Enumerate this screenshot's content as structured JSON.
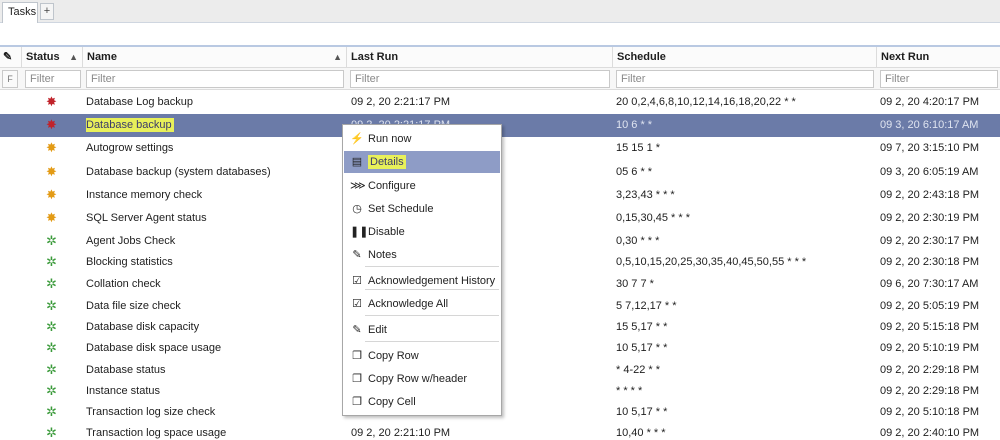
{
  "tabs": [
    {
      "label": "Tasks"
    }
  ],
  "add_tab_label": "+",
  "columns": {
    "status": "Status",
    "name": "Name",
    "last_run": "Last Run",
    "schedule": "Schedule",
    "next_run": "Next Run"
  },
  "filter": {
    "button": "F",
    "placeholder": "Filter"
  },
  "rows": [
    {
      "status": "error",
      "name": "Database Log backup",
      "last_run": "09 2, 20 2:21:17 PM",
      "schedule": "20 0,2,4,6,8,10,12,14,16,18,20,22 * *",
      "next_run": "09 2, 20 4:20:17 PM"
    },
    {
      "status": "error",
      "name": "Database backup",
      "last_run": "09 2, 20 2:21:17 PM",
      "schedule": "10 6 * *",
      "next_run": "09 3, 20 6:10:17 AM"
    },
    {
      "status": "warning",
      "name": "Autogrow settings",
      "last_run": "",
      "schedule": "15 15 1 *",
      "next_run": "09 7, 20 3:15:10 PM"
    },
    {
      "status": "warning",
      "name": "Database backup (system databases)",
      "last_run": "",
      "schedule": "05 6 * *",
      "next_run": "09 3, 20 6:05:19 AM"
    },
    {
      "status": "warning",
      "name": "Instance memory check",
      "last_run": "",
      "schedule": "3,23,43 * * *",
      "next_run": "09 2, 20 2:43:18 PM"
    },
    {
      "status": "warning",
      "name": "SQL Server Agent status",
      "last_run": "",
      "schedule": "0,15,30,45 * * *",
      "next_run": "09 2, 20 2:30:19 PM"
    },
    {
      "status": "ok",
      "name": "Agent Jobs Check",
      "last_run": "",
      "schedule": "0,30 * * *",
      "next_run": "09 2, 20 2:30:17 PM"
    },
    {
      "status": "ok",
      "name": "Blocking statistics",
      "last_run": "",
      "schedule": "0,5,10,15,20,25,30,35,40,45,50,55 * * *",
      "next_run": "09 2, 20 2:30:18 PM"
    },
    {
      "status": "ok",
      "name": "Collation check",
      "last_run": "",
      "schedule": "30 7 7 *",
      "next_run": "09 6, 20 7:30:17 AM"
    },
    {
      "status": "ok",
      "name": "Data file size check",
      "last_run": "",
      "schedule": "5 7,12,17 * *",
      "next_run": "09 2, 20 5:05:19 PM"
    },
    {
      "status": "ok",
      "name": "Database disk capacity",
      "last_run": "",
      "schedule": "15 5,17 * *",
      "next_run": "09 2, 20 5:15:18 PM"
    },
    {
      "status": "ok",
      "name": "Database disk space usage",
      "last_run": "",
      "schedule": "10 5,17 * *",
      "next_run": "09 2, 20 5:10:19 PM"
    },
    {
      "status": "ok",
      "name": "Database status",
      "last_run": "",
      "schedule": "* 4-22 * *",
      "next_run": "09 2, 20 2:29:18 PM"
    },
    {
      "status": "ok",
      "name": "Instance status",
      "last_run": "",
      "schedule": "* * * *",
      "next_run": "09 2, 20 2:29:18 PM"
    },
    {
      "status": "ok",
      "name": "Transaction log size check",
      "last_run": "",
      "schedule": "10 5,17 * *",
      "next_run": "09 2, 20 5:10:18 PM"
    },
    {
      "status": "ok",
      "name": "Transaction log space usage",
      "last_run": "09 2, 20 2:21:10 PM",
      "schedule": "10,40 * * *",
      "next_run": "09 2, 20 2:40:10 PM"
    }
  ],
  "context_menu": {
    "items": [
      {
        "label": "Run now",
        "icon": "lightning-icon",
        "glyph": "⚡"
      },
      {
        "label": "Details",
        "icon": "details-icon",
        "glyph": "▤"
      },
      {
        "label": "Configure",
        "icon": "configure-icon",
        "glyph": "⋙"
      },
      {
        "label": "Set Schedule",
        "icon": "clock-icon",
        "glyph": "◷"
      },
      {
        "label": "Disable",
        "icon": "pause-icon",
        "glyph": "❚❚"
      },
      {
        "label": "Notes",
        "icon": "notes-icon",
        "glyph": "✎"
      },
      {
        "label": "Acknowledgement History",
        "icon": "acknowledge-history-icon",
        "glyph": "☑"
      },
      {
        "label": "Acknowledge All",
        "icon": "acknowledge-all-icon",
        "glyph": "☑"
      },
      {
        "label": "Edit",
        "icon": "edit-icon",
        "glyph": "✎"
      },
      {
        "label": "Copy Row",
        "icon": "copy-row-icon",
        "glyph": "❐"
      },
      {
        "label": "Copy Row w/header",
        "icon": "copy-row-header-icon",
        "glyph": "❐"
      },
      {
        "label": "Copy Cell",
        "icon": "copy-cell-icon",
        "glyph": "❐"
      }
    ]
  },
  "colors": {
    "selected_row": "#6b7ba8",
    "highlight": "#e8f05a",
    "status_error": "#c0232b",
    "status_warning": "#e39b16",
    "status_ok": "#3a9a3a"
  }
}
